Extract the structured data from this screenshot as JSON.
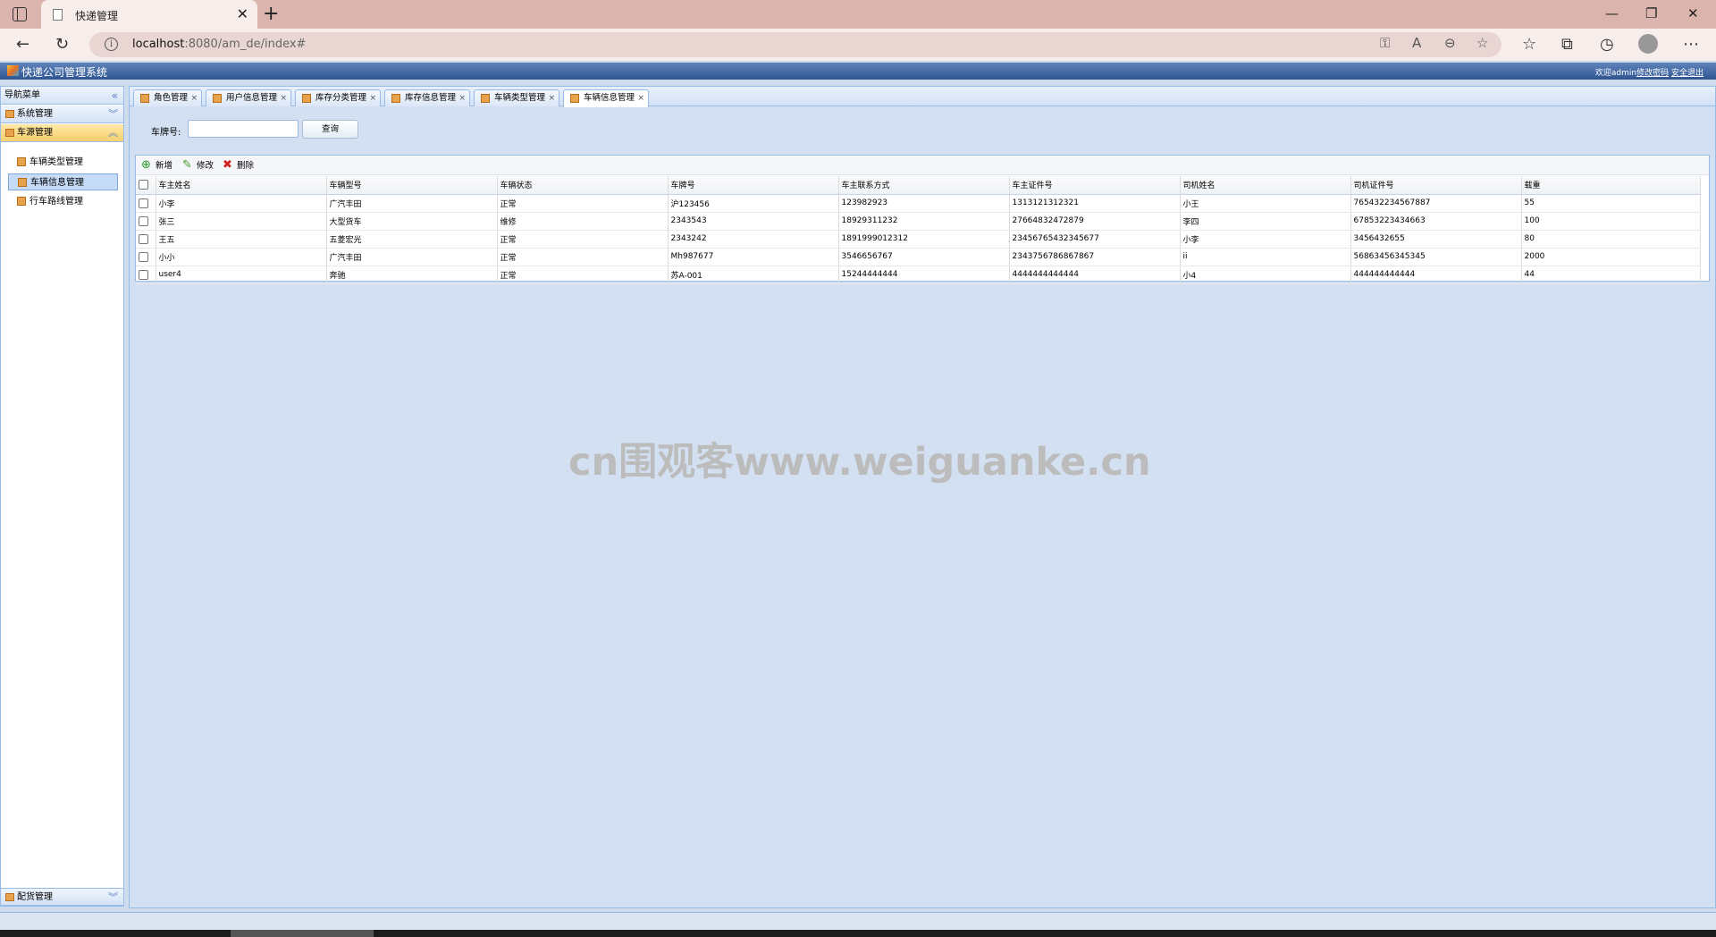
{
  "browser": {
    "tab_title": "快递管理",
    "url_host": "localhost",
    "url_rest": ":8080/am_de/index#"
  },
  "app": {
    "title": "快递公司管理系统",
    "welcome": "欢迎admin",
    "change_password": "修改密码",
    "logout": "安全退出"
  },
  "sidebar": {
    "header": "导航菜单",
    "sections": [
      {
        "label": "系统管理"
      },
      {
        "label": "车源管理"
      },
      {
        "label": "配货管理"
      }
    ],
    "items": [
      {
        "label": "车辆类型管理"
      },
      {
        "label": "车辆信息管理"
      },
      {
        "label": "行车路线管理"
      }
    ]
  },
  "tabs": [
    {
      "label": "角色管理"
    },
    {
      "label": "用户信息管理"
    },
    {
      "label": "库存分类管理"
    },
    {
      "label": "库存信息管理"
    },
    {
      "label": "车辆类型管理"
    },
    {
      "label": "车辆信息管理"
    }
  ],
  "search": {
    "label": "车牌号:",
    "value": "",
    "button": "查询"
  },
  "toolbar": {
    "add": "新增",
    "edit": "修改",
    "delete": "删除"
  },
  "table": {
    "columns": [
      "车主姓名",
      "车辆型号",
      "车辆状态",
      "车牌号",
      "车主联系方式",
      "车主证件号",
      "司机姓名",
      "司机证件号",
      "载重"
    ],
    "rows": [
      [
        "小李",
        "广汽丰田",
        "正常",
        "沪123456",
        "123982923",
        "1313121312321",
        "小王",
        "765432234567887",
        "55"
      ],
      [
        "张三",
        "大型货车",
        "维修",
        "2343543",
        "18929311232",
        "27664832472879",
        "李四",
        "67853223434663",
        "100"
      ],
      [
        "王五",
        "五菱宏光",
        "正常",
        "2343242",
        "1891999012312",
        "23456765432345677",
        "小李",
        "3456432655",
        "80"
      ],
      [
        "小小",
        "广汽丰田",
        "正常",
        "Mh987677",
        "3546656767",
        "2343756786867867",
        "ii",
        "56863456345345",
        "2000"
      ],
      [
        "user4",
        "奔驰",
        "正常",
        "苏A-001",
        "15244444444",
        "4444444444444",
        "小4",
        "444444444444",
        "44"
      ]
    ]
  },
  "watermark": "cn围观客www.weiguanke.cn",
  "icons": {
    "folder_color": "#e6a34b",
    "header_color": "#2f5592",
    "add_color": "#2a9a2a",
    "delete_color": "#d02020"
  }
}
